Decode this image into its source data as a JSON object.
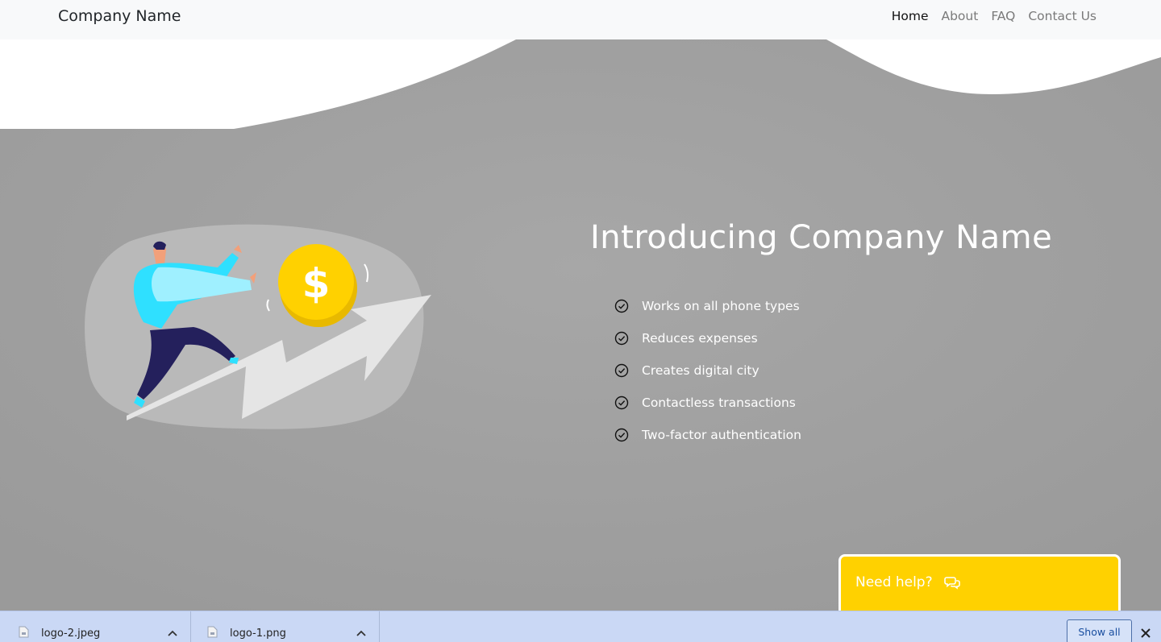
{
  "navbar": {
    "brand": "Company Name",
    "links": [
      "Home",
      "About",
      "FAQ",
      "Contact Us"
    ],
    "active": "Home"
  },
  "hero": {
    "headline": "Introducing Company Name",
    "features": [
      "Works on all phone types",
      "Reduces expenses",
      "Creates digital city",
      "Contactless transactions",
      "Two-factor authentication"
    ],
    "illustration_icon": "person-running-growth-arrow-coin-illustration"
  },
  "help_widget": {
    "label": "Need help?",
    "icon": "chat-bubbles-icon",
    "color": "#ffd100"
  },
  "downloads": {
    "items": [
      {
        "name": "logo-2.jpeg"
      },
      {
        "name": "logo-1.png"
      }
    ],
    "show_all_label": "Show all"
  },
  "colors": {
    "hero_background": "#a2a2a2",
    "navbar_background": "#f8f9fa",
    "download_bar": "#cad8f5",
    "coin": "#ffd100",
    "person_shirt": "#2fe0ff",
    "person_pants": "#24205c"
  }
}
